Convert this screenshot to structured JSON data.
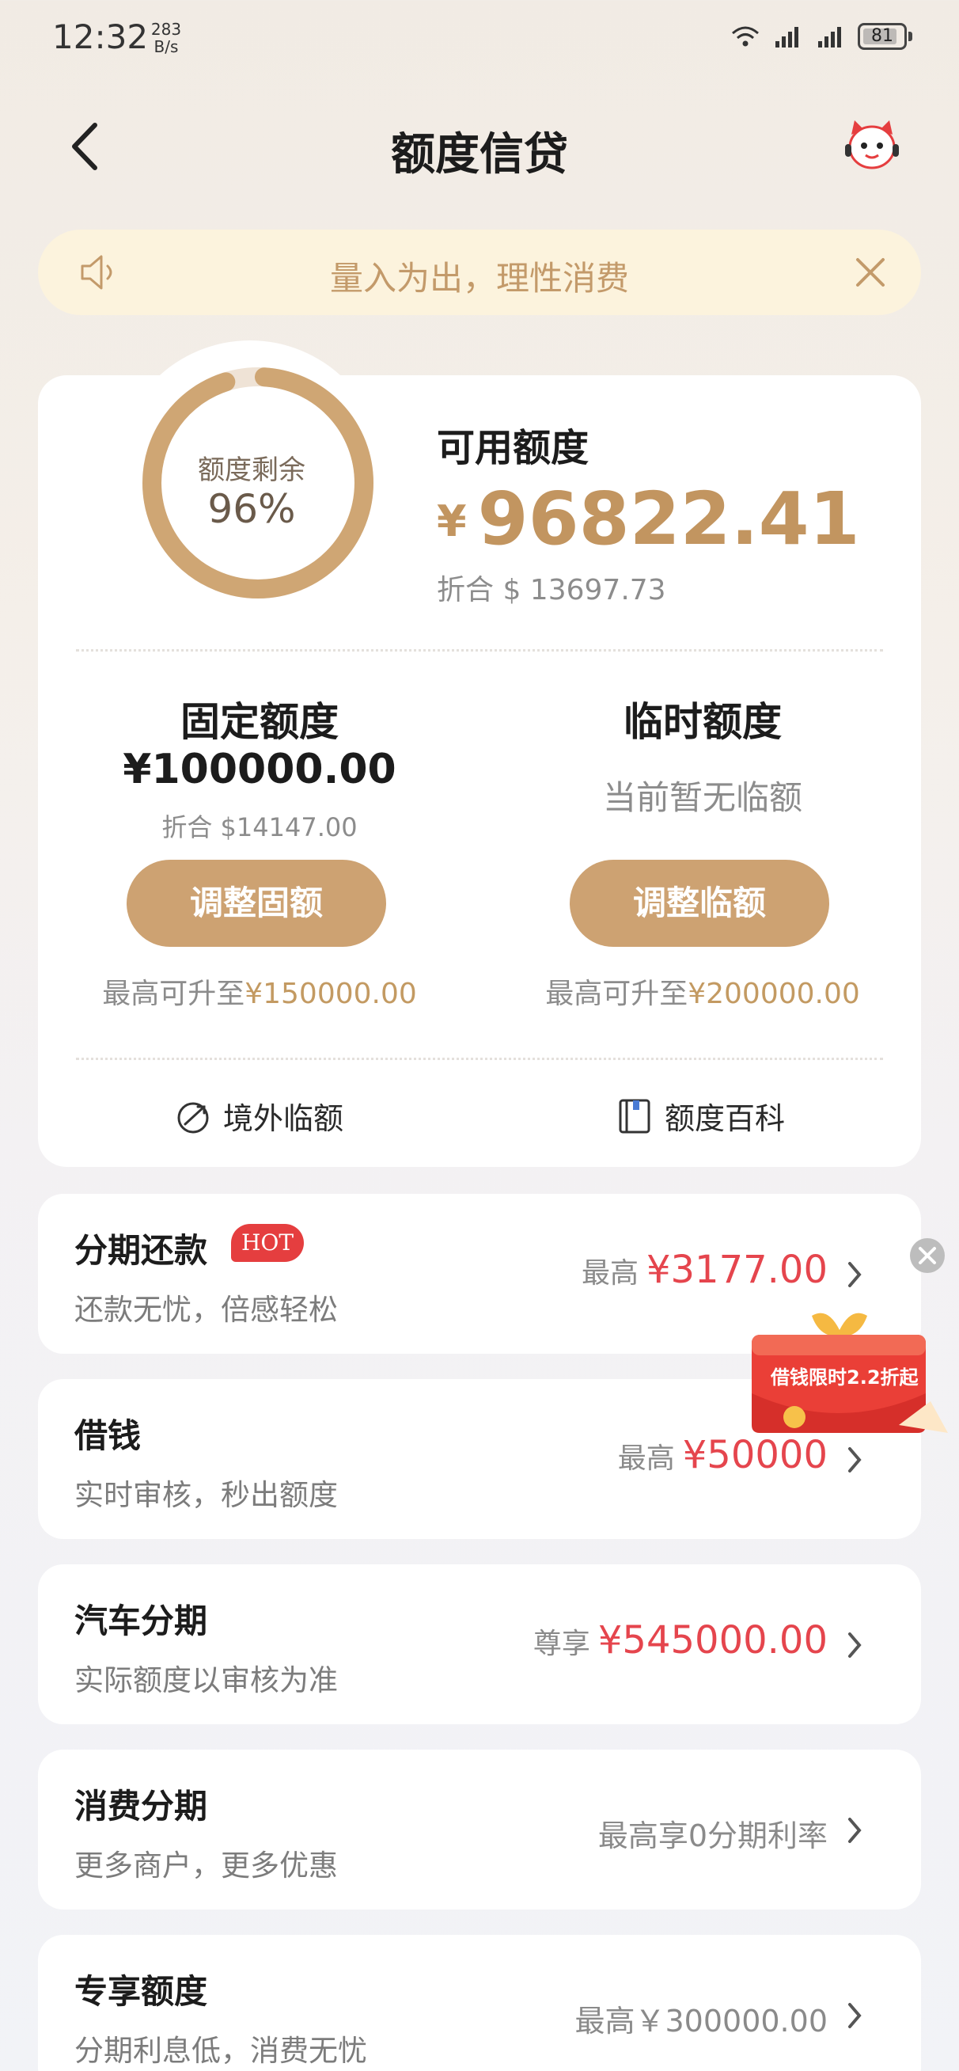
{
  "status_bar": {
    "time": "12:32",
    "speed_value": "283",
    "speed_unit": "B/s",
    "battery": "81"
  },
  "nav": {
    "title": "额度信贷"
  },
  "notice": {
    "text": "量入为出，理性消费"
  },
  "summary": {
    "ring_label": "额度剩余",
    "ring_percent": "96%",
    "ring_fraction": 0.96,
    "available_title": "可用额度",
    "available_currency": "¥",
    "available_amount": "96822.41",
    "available_equiv": "折合 $ 13697.73"
  },
  "fixed": {
    "title": "固定额度",
    "amount": "¥100000.00",
    "equiv": "折合 $14147.00",
    "button": "调整固额",
    "max_prefix": "最高可升至",
    "max_value": "¥150000.00"
  },
  "temporary": {
    "title": "临时额度",
    "none_text": "当前暂无临额",
    "button": "调整临额",
    "max_prefix": "最高可升至",
    "max_value": "¥200000.00"
  },
  "links": {
    "overseas": "境外临额",
    "encyclopedia": "额度百科"
  },
  "rows": [
    {
      "title": "分期还款",
      "badge": "HOT",
      "sub": "还款无忧，倍感轻松",
      "label": "最高",
      "value": "¥3177.00"
    },
    {
      "title": "借钱",
      "sub": "实时审核，秒出额度",
      "label": "最高",
      "value": "¥50000"
    },
    {
      "title": "汽车分期",
      "sub": "实际额度以审核为准",
      "label": "尊享",
      "value": "¥545000.00"
    },
    {
      "title": "消费分期",
      "sub": "更多商户，更多优惠",
      "plain": "最高享0分期利率"
    },
    {
      "title": "专享额度",
      "sub": "分期利息低，消费无忧",
      "plain": "最高￥300000.00"
    }
  ],
  "promo": {
    "text": "借钱限时2.2折起"
  },
  "colors": {
    "gold": "#cda272",
    "accent_red": "#e5454d",
    "notice_bg": "#fcf3dd"
  }
}
